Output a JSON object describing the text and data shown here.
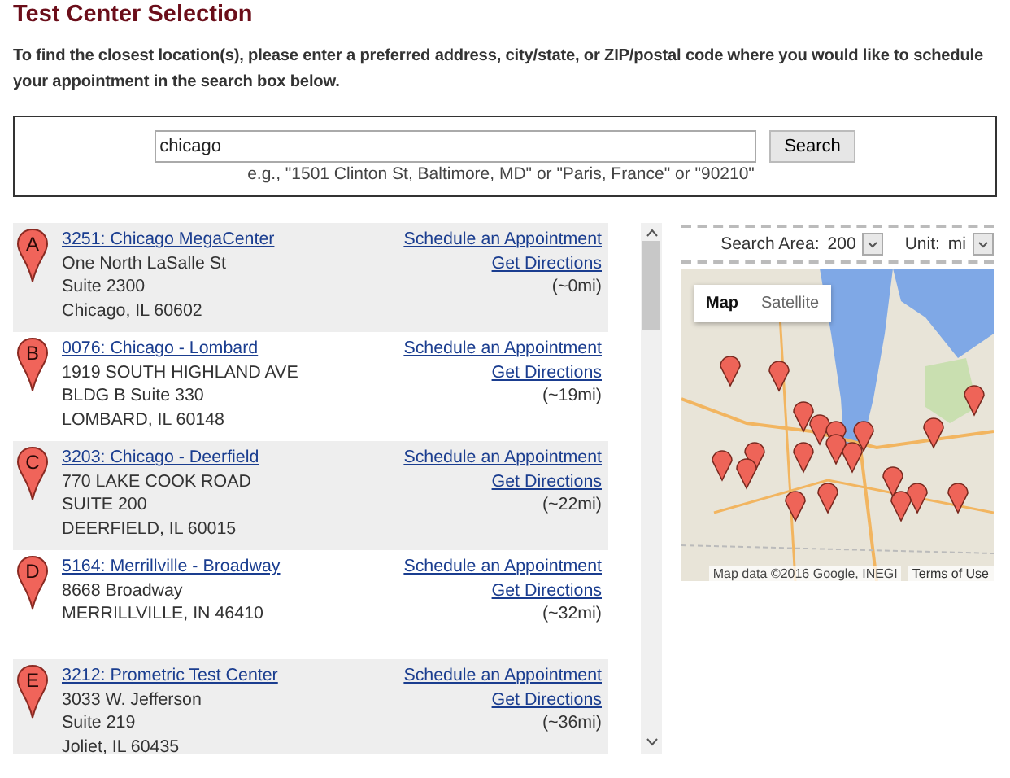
{
  "title": "Test Center Selection",
  "instructions": "To find the closest location(s), please enter a preferred address, city/state, or ZIP/postal code where you would like to schedule your appointment in the search box below.",
  "search": {
    "value": "chicago",
    "button": "Search",
    "hint": "e.g., \"1501 Clinton St, Baltimore, MD\" or \"Paris, France\" or \"90210\""
  },
  "results": [
    {
      "marker": "A",
      "name": "3251: Chicago MegaCenter",
      "address": [
        "One North LaSalle St",
        "Suite 2300",
        "Chicago, IL 60602"
      ],
      "schedule": "Schedule an Appointment",
      "directions": "Get Directions",
      "distance": "(~0mi)"
    },
    {
      "marker": "B",
      "name": "0076: Chicago - Lombard",
      "address": [
        "1919 SOUTH HIGHLAND AVE",
        "BLDG B Suite 330",
        "LOMBARD, IL 60148"
      ],
      "schedule": "Schedule an Appointment",
      "directions": "Get Directions",
      "distance": "(~19mi)"
    },
    {
      "marker": "C",
      "name": "3203: Chicago - Deerfield",
      "address": [
        "770 LAKE COOK ROAD",
        "SUITE 200",
        "DEERFIELD, IL 60015"
      ],
      "schedule": "Schedule an Appointment",
      "directions": "Get Directions",
      "distance": "(~22mi)"
    },
    {
      "marker": "D",
      "name": "5164: Merrillville - Broadway",
      "address": [
        "8668 Broadway",
        "MERRILLVILLE, IN 46410"
      ],
      "schedule": "Schedule an Appointment",
      "directions": "Get Directions",
      "distance": "(~32mi)"
    },
    {
      "marker": "E",
      "name": "3212: Prometric Test Center",
      "address": [
        "3033 W. Jefferson",
        "Suite 219",
        "Joliet, IL 60435"
      ],
      "schedule": "Schedule an Appointment",
      "directions": "Get Directions",
      "distance": "(~36mi)"
    }
  ],
  "map": {
    "search_area_label": "Search Area:",
    "search_area": "200",
    "unit_label": "Unit:",
    "unit": "mi",
    "map_types": [
      {
        "label": "Map",
        "selected": true
      },
      {
        "label": "Satellite",
        "selected": false
      }
    ],
    "attribution": "Map data ©2016 Google, INEGI",
    "terms": "Terms of Use"
  }
}
